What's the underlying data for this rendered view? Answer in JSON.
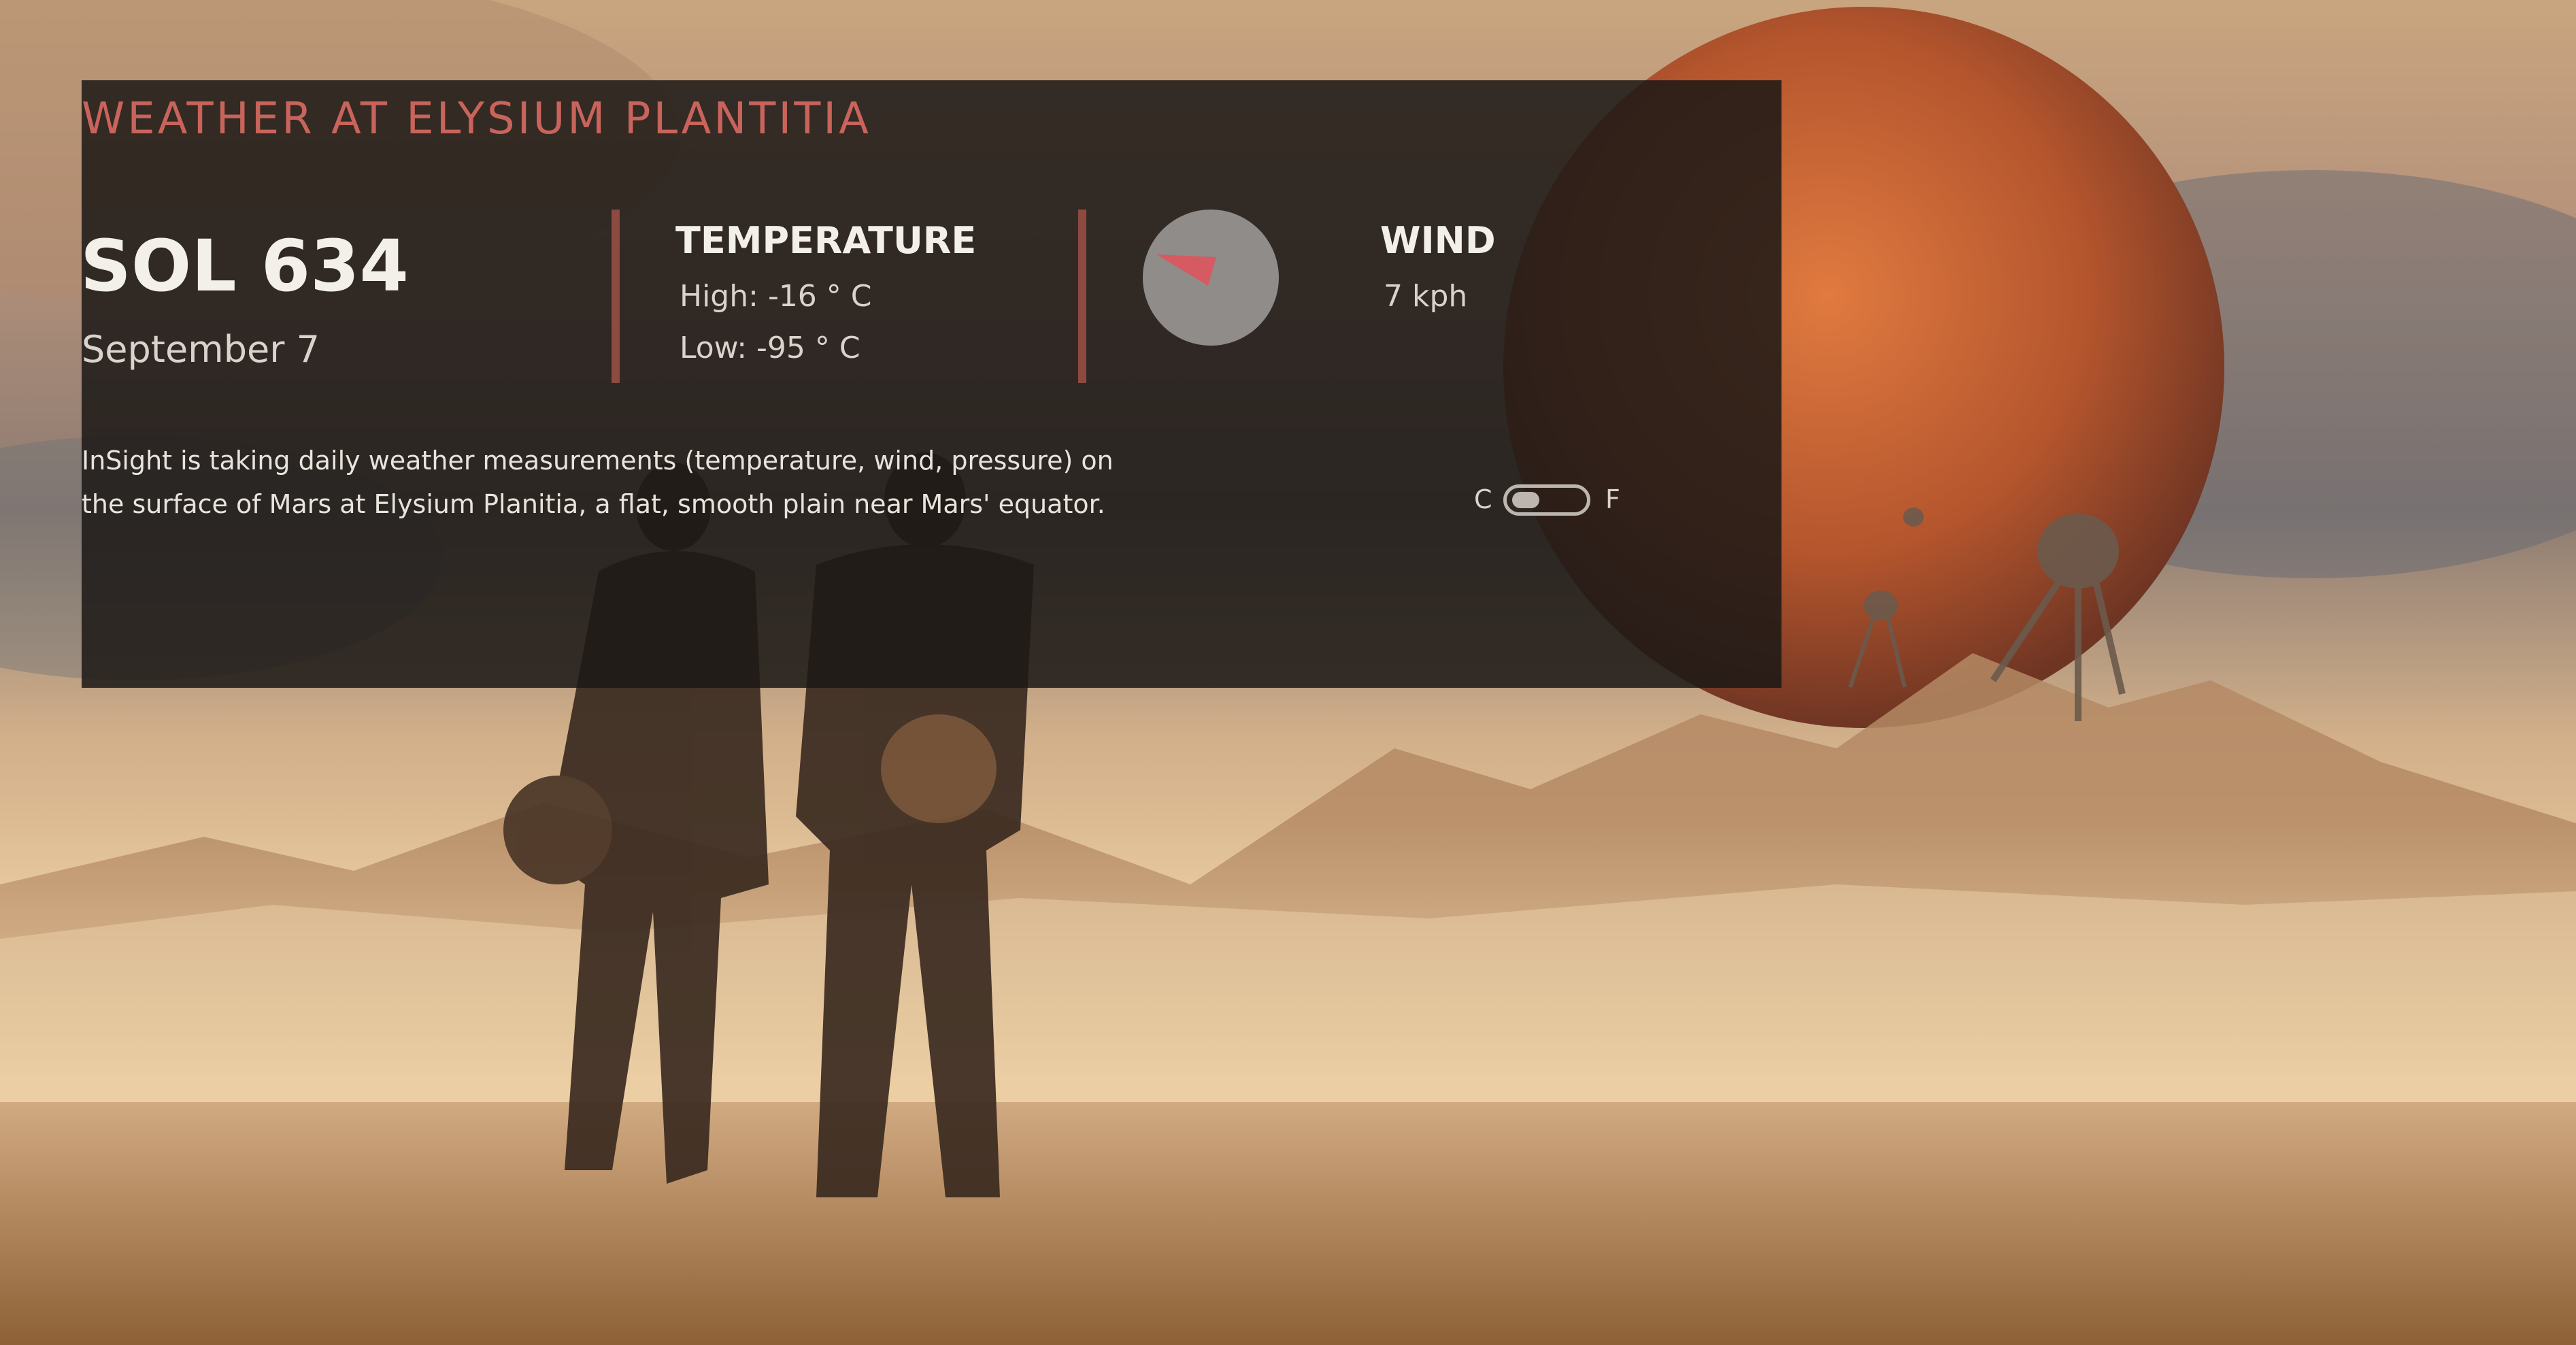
{
  "header": {
    "location_title": "WEATHER AT ELYSIUM PLANTITIA"
  },
  "sol": {
    "title": "SOL 634",
    "date": "September 7"
  },
  "temperature": {
    "heading": "TEMPERATURE",
    "high": "High: -16 ° C",
    "low": "Low: -95 ° C"
  },
  "wind": {
    "heading": "WIND",
    "speed": "7 kph",
    "compass_icon": "wind-direction-compass",
    "pointer_color": "#d65a62"
  },
  "description": "InSight is taking daily weather measurements (temperature, wind, pressure) on the surface of Mars at Elysium Planitia, a flat, smooth plain near Mars' equator.",
  "unit_toggle": {
    "left_label": "C",
    "right_label": "F",
    "selected": "C"
  },
  "colors": {
    "accent": "#c8645c",
    "panel": "#1c1816",
    "divider": "#8c4a40"
  }
}
